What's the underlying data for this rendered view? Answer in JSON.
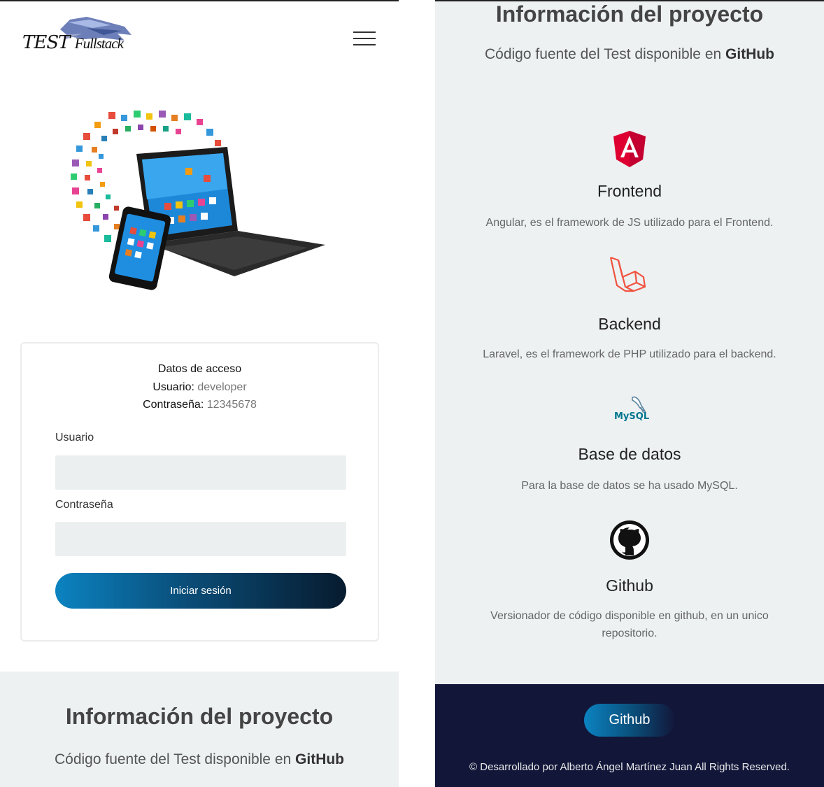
{
  "header": {
    "logo_main": "TEST",
    "logo_sub": "Fullstack"
  },
  "access": {
    "title": "Datos de acceso",
    "user_label": "Usuario:",
    "user_value": "developer",
    "pass_label": "Contraseña:",
    "pass_value": "12345678"
  },
  "login": {
    "user_field_label": "Usuario",
    "user_field_value": "",
    "pass_field_label": "Contraseña",
    "pass_field_value": "",
    "submit_label": "Iniciar sesión"
  },
  "project_info": {
    "title": "Información del proyecto",
    "subtitle_prefix": "Código fuente del Test disponible en",
    "github_link": "GitHub"
  },
  "technologies": [
    {
      "icon": "angular-icon",
      "title": "Frontend",
      "description": "Angular, es el framework de JS utilizado para el Frontend."
    },
    {
      "icon": "laravel-icon",
      "title": "Backend",
      "description": "Laravel, es el framework de PHP utilizado para el backend."
    },
    {
      "icon": "mysql-icon",
      "title": "Base de datos",
      "description": "Para la base de datos se ha usado MySQL.",
      "icon_text": "MySQL"
    },
    {
      "icon": "github-icon",
      "title": "Github",
      "description": "Versionador de código disponible en github, en un unico repositorio."
    }
  ],
  "footer": {
    "button_label": "Github",
    "copyright": "© Desarrollado por Alberto Ángel Martínez Juan All Rights Reserved."
  },
  "colors": {
    "panel_bg": "#edf1f2",
    "footer_bg": "#12173a",
    "button_gradient_start": "#0b83c1",
    "button_gradient_end": "#071b2e",
    "angular_red": "#dd0031",
    "laravel_red": "#f05340"
  }
}
